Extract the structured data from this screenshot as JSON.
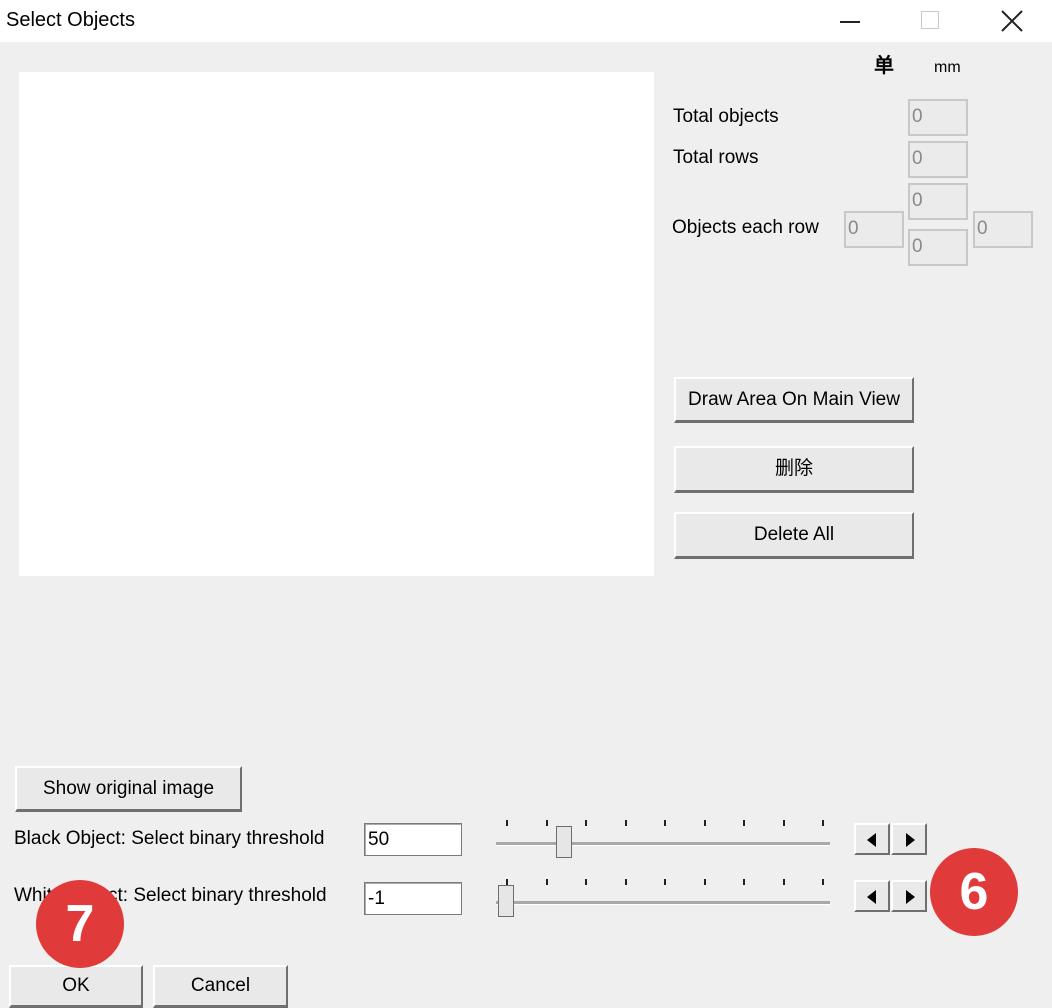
{
  "window": {
    "title": "Select Objects",
    "controls": {
      "minimize": "minimize-icon",
      "maximize": "maximize-icon",
      "close": "close-icon"
    }
  },
  "units": {
    "primary": "单",
    "secondary": "mm"
  },
  "stats": {
    "total_objects_label": "Total objects",
    "total_objects_value": "0",
    "total_rows_label": "Total rows",
    "total_rows_value": "0",
    "objects_each_row_label": "Objects each row",
    "objects_each_row_values": [
      "0",
      "0",
      "0",
      "0"
    ]
  },
  "buttons": {
    "draw_area": "Draw Area On Main View",
    "delete": "删除",
    "delete_all": "Delete All",
    "show_original": "Show original image",
    "ok": "OK",
    "cancel": "Cancel"
  },
  "thresholds": {
    "black_label": "Black Object: Select binary threshold",
    "black_value": "50",
    "black_slider_fraction": 0.19,
    "white_label": "White Object: Select binary threshold",
    "white_value": "-1",
    "white_slider_fraction": 0.0
  },
  "badges": {
    "left": "7",
    "right": "6"
  },
  "colors": {
    "badge": "#e03a3a",
    "background": "#efefef"
  }
}
